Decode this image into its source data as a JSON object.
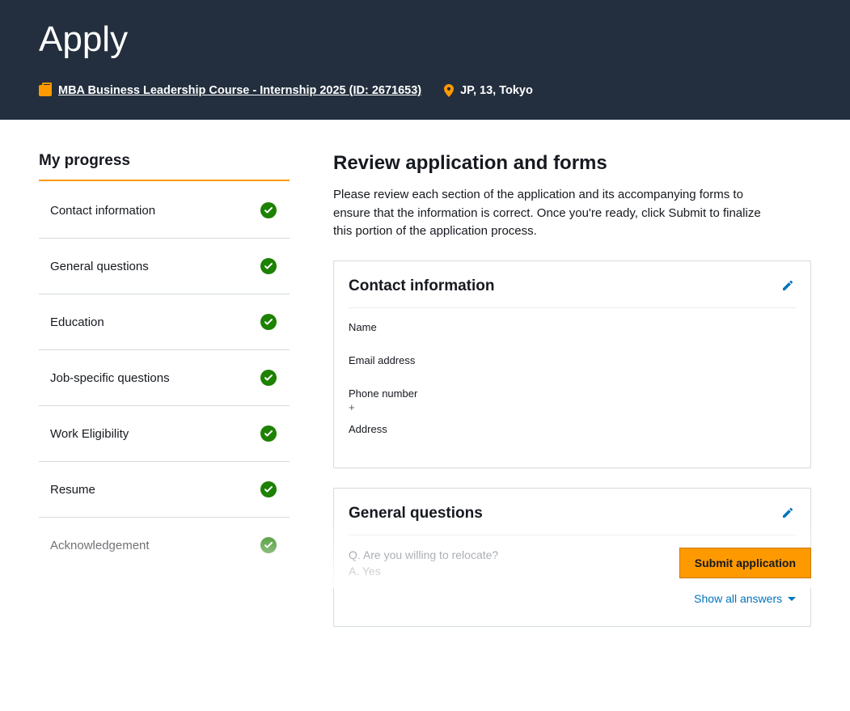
{
  "header": {
    "title": "Apply",
    "job_link": "MBA Business Leadership Course - Internship 2025 (ID: 2671653)",
    "location": "JP, 13, Tokyo"
  },
  "sidebar": {
    "heading": "My progress",
    "items": [
      {
        "label": "Contact information",
        "complete": true
      },
      {
        "label": "General questions",
        "complete": true
      },
      {
        "label": "Education",
        "complete": true
      },
      {
        "label": "Job-specific questions",
        "complete": true
      },
      {
        "label": "Work Eligibility",
        "complete": true
      },
      {
        "label": "Resume",
        "complete": true
      },
      {
        "label": "Acknowledgement",
        "complete": true
      }
    ]
  },
  "main": {
    "title": "Review application and forms",
    "description": "Please review each section of the application and its accompanying forms to ensure that the information is correct. Once you're ready, click Submit to finalize this portion of the application process."
  },
  "contact_card": {
    "title": "Contact information",
    "name_label": "Name",
    "name_value": " ",
    "email_label": "Email address",
    "email_value": " ",
    "phone_label": "Phone number",
    "phone_value": "+",
    "address_label": "Address",
    "address_value": ""
  },
  "general_card": {
    "title": "General questions",
    "q1_label": "Q. Are you willing to relocate?",
    "q1_answer": "A. Yes",
    "show_all": "Show all answers"
  },
  "footer": {
    "submit_label": "Submit application"
  },
  "colors": {
    "header_bg": "#232f3e",
    "accent_orange": "#ff9900",
    "check_green": "#1d8102",
    "link_blue": "#0073bb"
  }
}
